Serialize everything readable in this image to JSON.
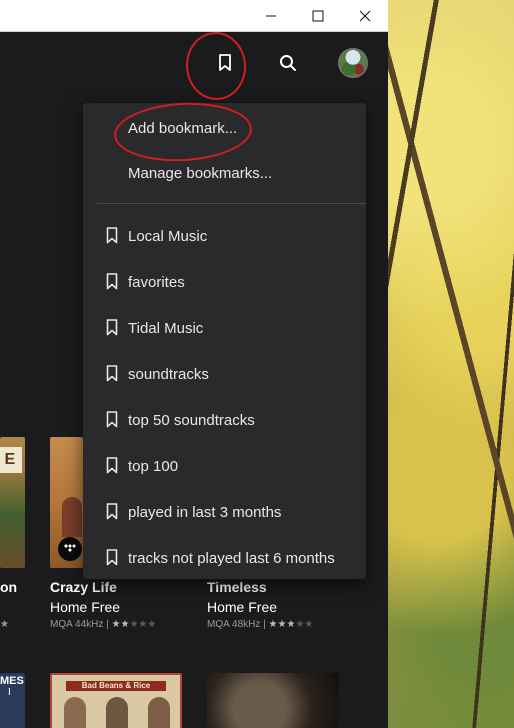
{
  "menu": {
    "add_bookmark": "Add bookmark...",
    "manage_bookmarks": "Manage bookmarks...",
    "bookmarks": [
      "Local Music",
      "favorites",
      "Tidal Music",
      "soundtracks",
      "top 50 soundtracks",
      "top 100",
      "played in last 3 months",
      "tracks not played last 6 months"
    ]
  },
  "albums": [
    {
      "title_fragment": "on",
      "meta_fragment": "★"
    },
    {
      "title": "Crazy Life",
      "artist": "Home Free",
      "quality": "MQA 44kHz |",
      "rating": 2
    },
    {
      "title": "Timeless",
      "artist": "Home Free",
      "quality": "MQA 48kHz |",
      "rating": 3
    }
  ],
  "bottom_row": {
    "left_fragment_1": "MES",
    "left_fragment_2": "I",
    "center_banner": "Bad Beans & Rice"
  },
  "colors": {
    "app_background": "#1b1b1d",
    "menu_background": "#2a2a2c",
    "annotation_red": "#d21e1e"
  },
  "icons": {
    "bookmark": "bookmark-icon",
    "search": "search-icon",
    "minimize": "minimize-icon",
    "maximize": "maximize-icon",
    "close": "close-icon"
  }
}
